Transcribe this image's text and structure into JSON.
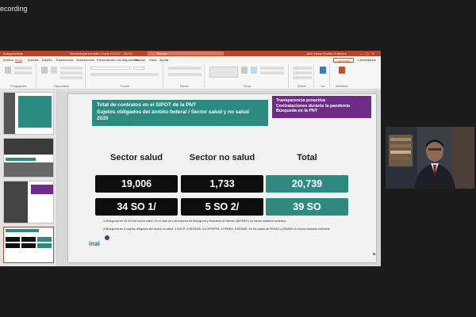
{
  "recording_label": "ecording",
  "window": {
    "title_left": "Autoguardado",
    "title_center": "Metodología contrato Covid-19 SCC - 30/10/",
    "search_placeholder": "Buscar",
    "user": "Julio César Bonilla Gutiérrez",
    "share_label": "Compartir",
    "comments_label": "Comentarios"
  },
  "tabs": [
    "Archivo",
    "Inicio",
    "Insertar",
    "Diseño",
    "Transiciones",
    "Animaciones",
    "Presentación con diapositivas",
    "Revisar",
    "Vista",
    "Ayuda"
  ],
  "active_tab": "Inicio",
  "ribbon_groups": [
    "Portapapeles",
    "Diapositivas",
    "Fuente",
    "Párrafo",
    "Dibujo",
    "Edición",
    "Voz",
    "Diseñador"
  ],
  "slide": {
    "title_line1": "Total de contratos en el SIPOT de la PNT",
    "title_line2": "Sujetos obligados del ámbito federal / Sector salud y no salud",
    "title_line3": "2020",
    "side_box": [
      "Transparencia proactiva",
      "Contrataciones durante la pandemia",
      "Búsqueda en la PNT"
    ],
    "columns": [
      "Sector salud",
      "Sector no salud",
      "Total"
    ],
    "row1": [
      "19,006",
      "1,733",
      "20,739"
    ],
    "row2": [
      "34 SO 1/",
      "5 SO 2/",
      "39 SO"
    ],
    "footnote1": "1/ Búsqueda en 34 SO del sector salud. En el caso de Laboratorios de Biológicos y Reactivos de México (BIRMEX) no fueron hallados contratos.",
    "footnote2": "2/ Búsqueda en 5 sujetos obligados del sector no salud: 1.SHCP; 2.SEDENA; 3.COFEPRIS; 4.PEMEX; 5.SEMAR. En los casos de PEMEX y SEMAR no fueron hallados contratos.",
    "logo_text": "inai"
  },
  "colors": {
    "accent": "#b7472a",
    "teal": "#2f8a82",
    "purple": "#6e2b87",
    "dark": "#0d0d0d"
  }
}
